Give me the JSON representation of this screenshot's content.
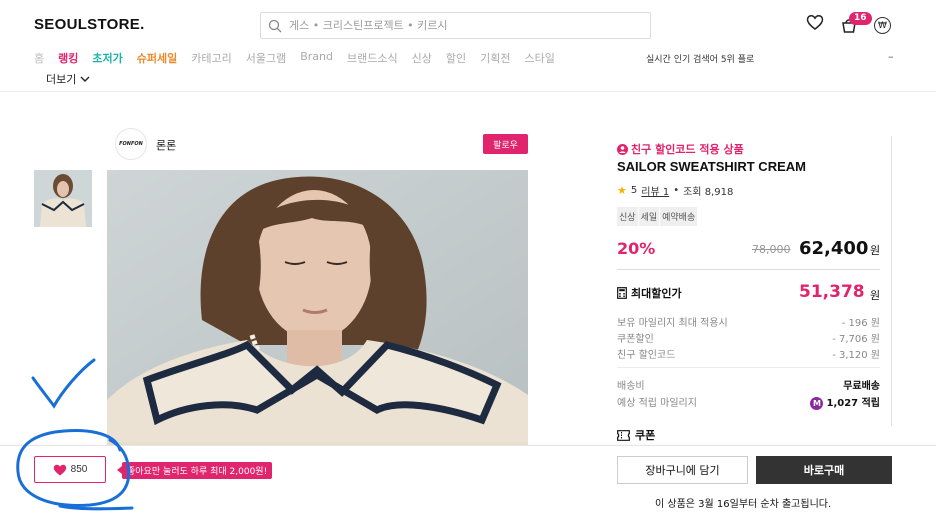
{
  "header": {
    "logo": "SEOULSTORE.",
    "search_placeholder": "게스 • 크리스틴프로젝트 • 키르시",
    "cart_count": "16",
    "won_symbol": "₩"
  },
  "nav": {
    "items": [
      "홈",
      "랭킹",
      "초저가",
      "슈퍼세일",
      "카테고리",
      "서울그램",
      "Brand",
      "브랜드소식",
      "신상",
      "할인",
      "기획전",
      "스타일"
    ],
    "realtime": "실시간 인기 검색어  5위 플로",
    "dash": "–",
    "more": "더보기"
  },
  "seller": {
    "logo_text": "FONFON",
    "name": "론론",
    "follow": "팔로우"
  },
  "product": {
    "friend_code": "친구 할인코드 적용 상품",
    "title": "SAILOR SWEATSHIRT CREAM",
    "rating": "5",
    "review": "리뷰 1",
    "dot": "•",
    "views": "조회 8,918",
    "tags": [
      "신상",
      "세일",
      "예약배송"
    ],
    "discount": "20%",
    "original_price": "78,000",
    "price": "62,400",
    "won": "원",
    "max_label": "최대할인가",
    "max_price": "51,378",
    "details": [
      {
        "label": "보유 마일리지 최대 적용시",
        "value": "- 196 원"
      },
      {
        "label": "쿠폰할인",
        "value": "- 7,706 원"
      },
      {
        "label": "친구 할인코드",
        "value": "- 3,120 원"
      }
    ],
    "shipping_label": "배송비",
    "shipping_value": "무료배송",
    "mileage_label": "예상 적립 마일리지",
    "mileage_badge": "M",
    "mileage_value": "1,027 적립",
    "coupon": "쿠폰"
  },
  "bottom": {
    "like_count": "850",
    "tip": "좋아요만 눌러도 하루 최대 2,000원!",
    "cart_button": "장바구니에 담기",
    "buy_button": "바로구매",
    "ship_note": "이 상품은 3월 16일부터 순차 출고됩니다."
  },
  "colors": {
    "accent": "#e0246d",
    "annotation": "#1a6fd6"
  }
}
